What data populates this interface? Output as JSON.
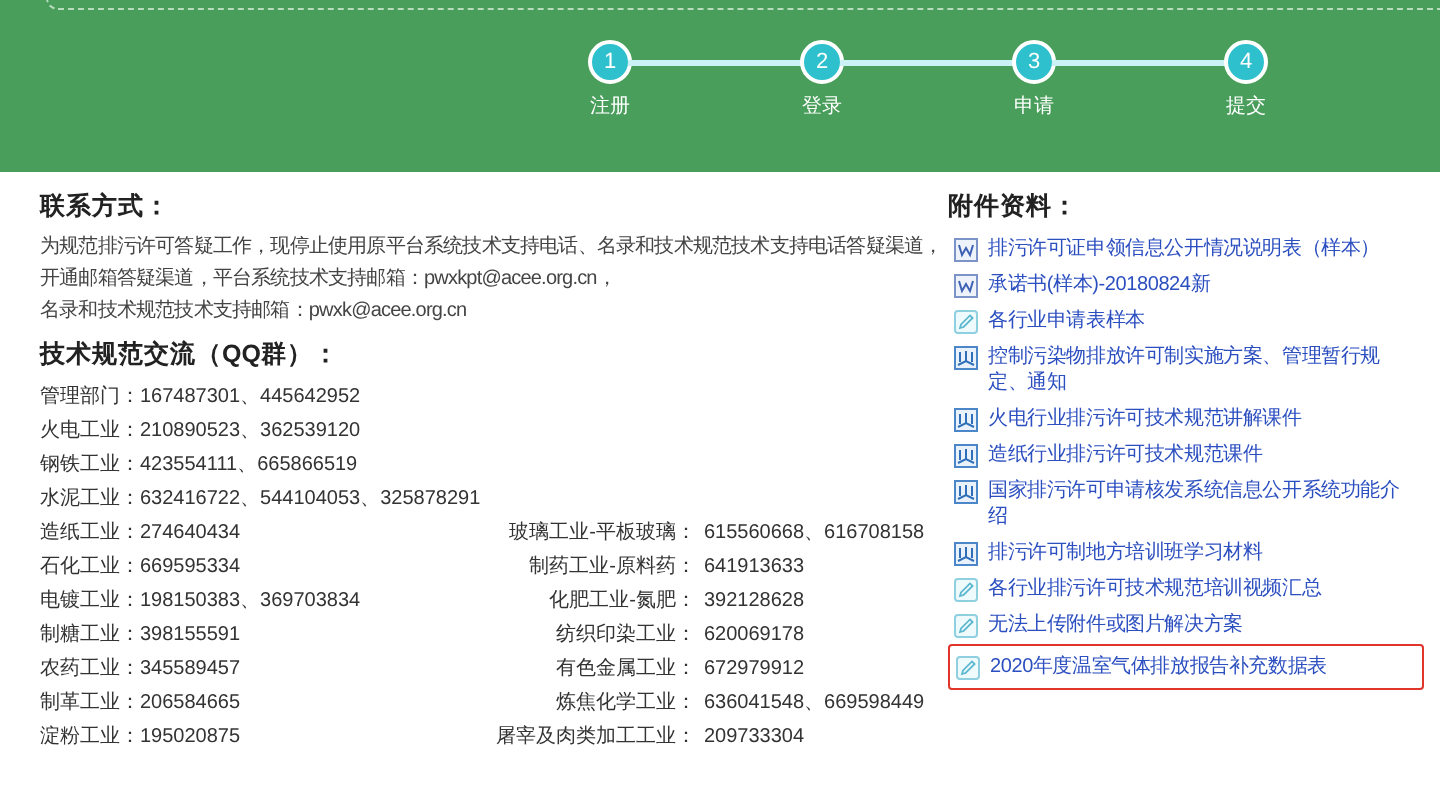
{
  "steps": [
    {
      "number": "1",
      "label": "注册"
    },
    {
      "number": "2",
      "label": "登录"
    },
    {
      "number": "3",
      "label": "申请"
    },
    {
      "number": "4",
      "label": "提交"
    }
  ],
  "contact": {
    "title": "联系方式：",
    "lines": [
      "为规范排污许可答疑工作，现停止使用原平台系统技术支持电话、名录和技术规范技术支持电话答疑渠道，",
      "开通邮箱答疑渠道，平台系统技术支持邮箱：pwxkpt@acee.org.cn，",
      "名录和技术规范技术支持邮箱：pwxk@acee.org.cn"
    ]
  },
  "qq": {
    "title": "技术规范交流（QQ群）：",
    "left": [
      "管理部门：167487301、445642952",
      "火电工业：210890523、362539120",
      "钢铁工业：423554111、665866519",
      "水泥工业：632416722、544104053、325878291",
      "造纸工业：274640434",
      "石化工业：669595334",
      "电镀工业：198150383、369703834",
      "制糖工业：398155591",
      "农药工业：345589457",
      "制革工业：206584665",
      "淀粉工业：195020875"
    ],
    "right": [
      {
        "label": "玻璃工业-平板玻璃：",
        "value": "615560668、616708158"
      },
      {
        "label": "制药工业-原料药：",
        "value": "641913633"
      },
      {
        "label": "化肥工业-氮肥：",
        "value": "392128628"
      },
      {
        "label": "纺织印染工业：",
        "value": "620069178"
      },
      {
        "label": "有色金属工业：",
        "value": "672979912"
      },
      {
        "label": "炼焦化学工业：",
        "value": "636041548、669598449"
      },
      {
        "label": "屠宰及肉类加工工业：",
        "value": "209733304"
      }
    ]
  },
  "attachments": {
    "title": "附件资料：",
    "items": [
      {
        "kind": "word",
        "text": "排污许可证申领信息公开情况说明表（样本）",
        "highlighted": false
      },
      {
        "kind": "word",
        "text": "承诺书(样本)-20180824新",
        "highlighted": false
      },
      {
        "kind": "pencil",
        "text": "各行业申请表样本",
        "highlighted": false
      },
      {
        "kind": "book",
        "text": "控制污染物排放许可制实施方案、管理暂行规定、通知",
        "highlighted": false
      },
      {
        "kind": "book",
        "text": "火电行业排污许可技术规范讲解课件",
        "highlighted": false
      },
      {
        "kind": "book",
        "text": "造纸行业排污许可技术规范课件",
        "highlighted": false
      },
      {
        "kind": "book",
        "text": "国家排污许可申请核发系统信息公开系统功能介绍",
        "highlighted": false
      },
      {
        "kind": "book",
        "text": "排污许可制地方培训班学习材料",
        "highlighted": false
      },
      {
        "kind": "pencil",
        "text": "各行业排污许可技术规范培训视频汇总",
        "highlighted": false
      },
      {
        "kind": "pencil",
        "text": "无法上传附件或图片解决方案",
        "highlighted": false
      },
      {
        "kind": "pencil",
        "text": "2020年度温室气体排放报告补充数据表",
        "highlighted": true
      }
    ]
  }
}
